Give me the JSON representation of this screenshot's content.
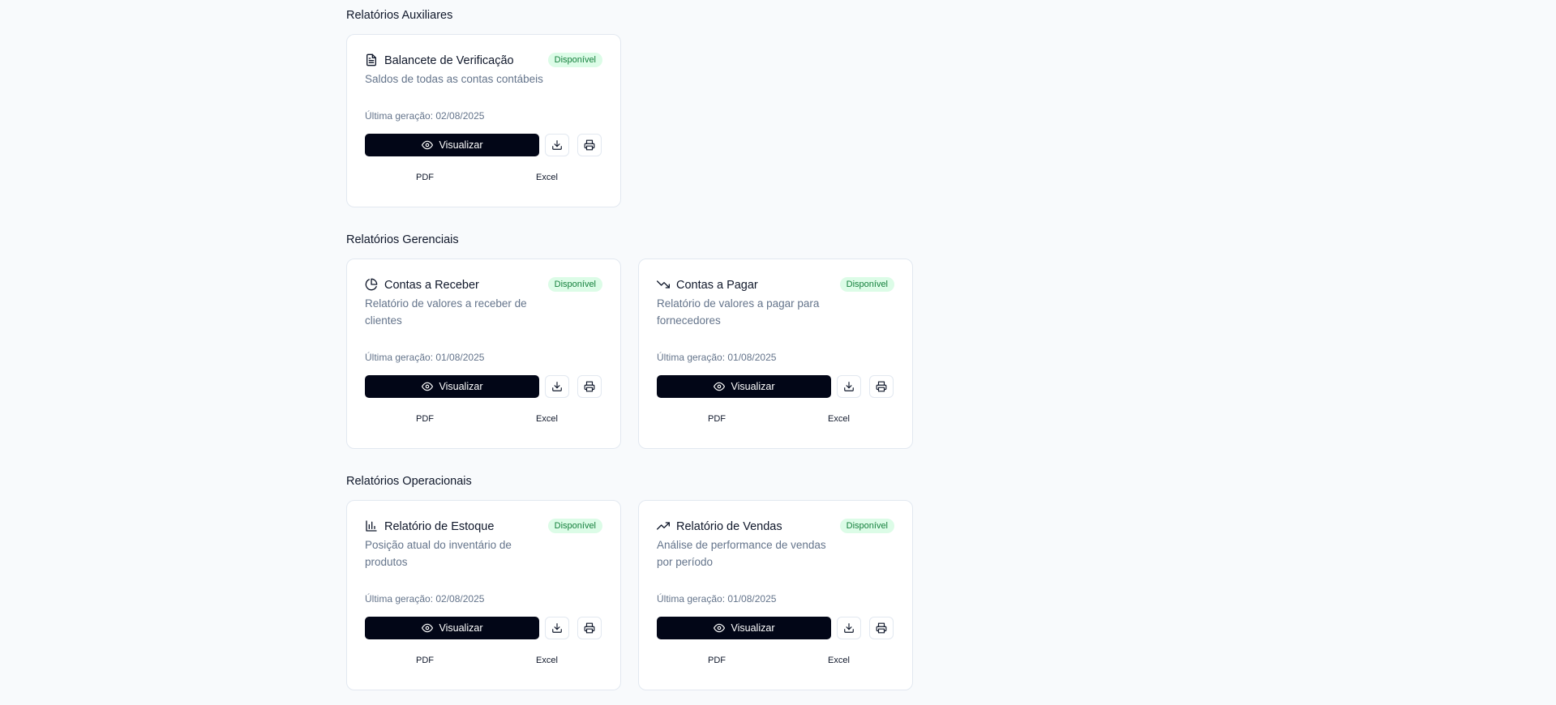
{
  "sections": [
    {
      "title": "Relatórios Auxiliares",
      "cards": [
        {
          "icon": "file-text-icon",
          "title": "Balancete de Verificação",
          "badge": "Disponível",
          "description": "Saldos de todas as contas contábeis",
          "last_generated": "Última geração: 02/08/2025",
          "view_label": "Visualizar",
          "format_pdf": "PDF",
          "format_excel": "Excel"
        }
      ]
    },
    {
      "title": "Relatórios Gerenciais",
      "cards": [
        {
          "icon": "pie-chart-icon",
          "title": "Contas a Receber",
          "badge": "Disponível",
          "description": "Relatório de valores a receber de clientes",
          "last_generated": "Última geração: 01/08/2025",
          "view_label": "Visualizar",
          "format_pdf": "PDF",
          "format_excel": "Excel"
        },
        {
          "icon": "trending-down-icon",
          "title": "Contas a Pagar",
          "badge": "Disponível",
          "description": "Relatório de valores a pagar para fornecedores",
          "last_generated": "Última geração: 01/08/2025",
          "view_label": "Visualizar",
          "format_pdf": "PDF",
          "format_excel": "Excel"
        }
      ]
    },
    {
      "title": "Relatórios Operacionais",
      "cards": [
        {
          "icon": "bar-chart-icon",
          "title": "Relatório de Estoque",
          "badge": "Disponível",
          "description": "Posição atual do inventário de produtos",
          "last_generated": "Última geração: 02/08/2025",
          "view_label": "Visualizar",
          "format_pdf": "PDF",
          "format_excel": "Excel"
        },
        {
          "icon": "trending-up-icon",
          "title": "Relatório de Vendas",
          "badge": "Disponível",
          "description": "Análise de performance de vendas por período",
          "last_generated": "Última geração: 01/08/2025",
          "view_label": "Visualizar",
          "format_pdf": "PDF",
          "format_excel": "Excel"
        }
      ]
    }
  ],
  "colors": {
    "badge_bg": "#dcfce7",
    "badge_text": "#15803d",
    "primary_button": "#020617"
  }
}
